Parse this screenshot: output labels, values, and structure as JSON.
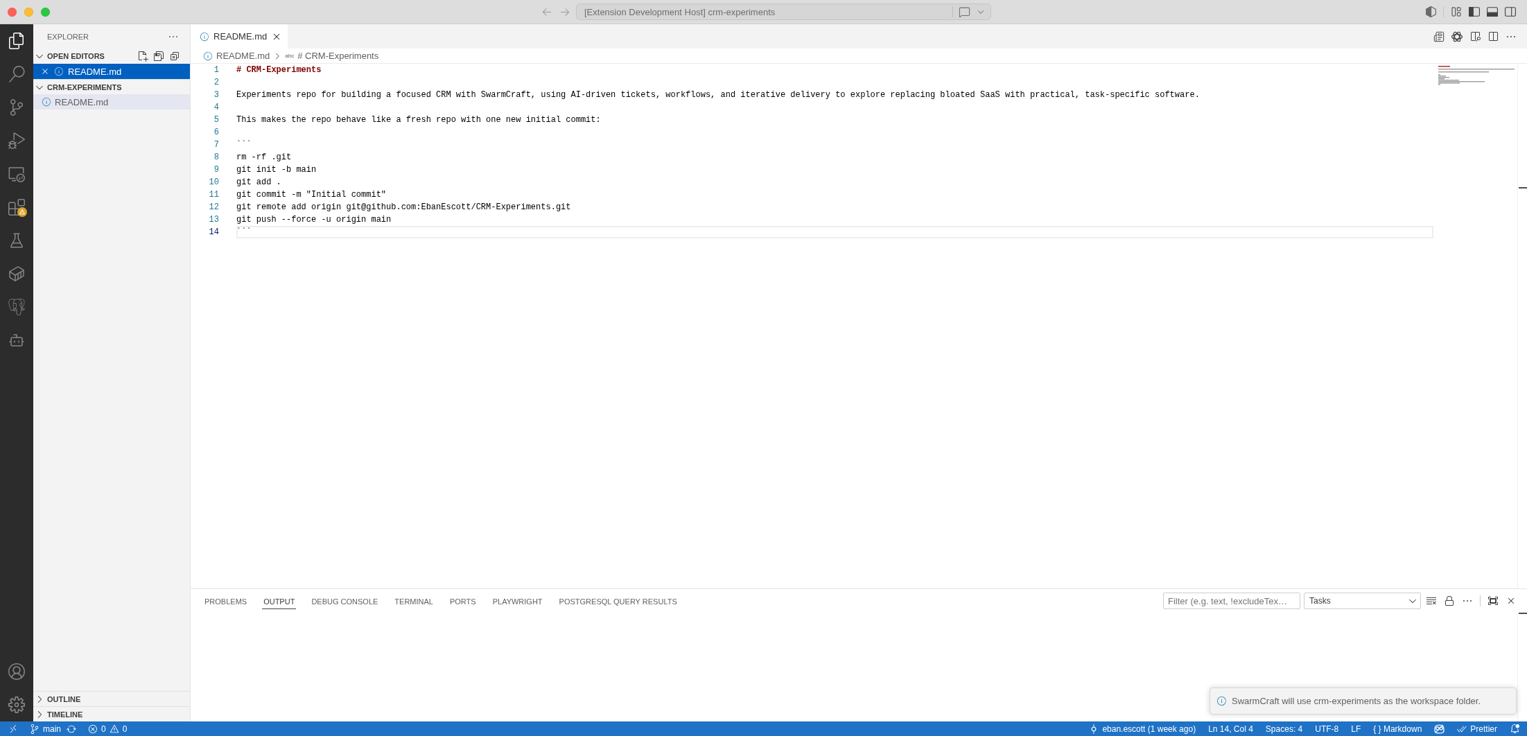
{
  "window": {
    "title": "[Extension Development Host] crm-experiments",
    "layout_toggles": [
      {
        "kind": "primary_sidebar",
        "on": true
      },
      {
        "kind": "panel",
        "on": true
      },
      {
        "kind": "secondary_sidebar",
        "on": false
      }
    ]
  },
  "activity_bar": {
    "items": [
      {
        "kind": "explorer",
        "selected": true,
        "warning": false
      },
      {
        "kind": "search",
        "selected": false,
        "warning": false
      },
      {
        "kind": "source_control",
        "selected": false,
        "warning": false
      },
      {
        "kind": "run_debug",
        "selected": false,
        "warning": false
      },
      {
        "kind": "remote_explorer",
        "selected": false,
        "warning": false
      },
      {
        "kind": "extensions",
        "selected": false,
        "warning": true
      },
      {
        "kind": "testing",
        "selected": false,
        "warning": false
      },
      {
        "kind": "containers",
        "selected": false,
        "warning": false
      },
      {
        "kind": "database",
        "selected": false,
        "warning": false
      },
      {
        "kind": "robot",
        "selected": false,
        "warning": false
      }
    ]
  },
  "sidebar": {
    "title": "EXPLORER",
    "sections": [
      {
        "kind": "open_editors",
        "title": "OPEN EDITORS",
        "expanded": true,
        "items": [
          {
            "label": "README.md",
            "selected": true,
            "focused": true
          }
        ]
      },
      {
        "kind": "folder",
        "title": "CRM-EXPERIMENTS",
        "expanded": true,
        "items": [
          {
            "label": "README.md",
            "selected": true,
            "focused": false
          }
        ]
      }
    ],
    "bottom_sections": [
      {
        "title": "OUTLINE",
        "expanded": false
      },
      {
        "title": "TIMELINE",
        "expanded": false
      }
    ]
  },
  "editor": {
    "tabs": [
      {
        "label": "README.md",
        "selected": true
      }
    ],
    "breadcrumbs": {
      "file": "README.md",
      "symbol_icon": "abc",
      "symbol": "# CRM-Experiments"
    },
    "lines": [
      {
        "number": "1",
        "kind": "heading",
        "text": "# CRM-Experiments",
        "current": false
      },
      {
        "number": "2",
        "current": false
      },
      {
        "number": "3",
        "kind": "plain",
        "text": "Experiments repo for building a focused CRM with SwarmCraft, using AI-driven tickets, workflows, and iterative delivery to explore replacing bloated SaaS with practical, task-specific software.",
        "current": false
      },
      {
        "number": "4",
        "current": false
      },
      {
        "number": "5",
        "kind": "plain",
        "text": "This makes the repo behave like a fresh repo with one new initial commit:",
        "current": false
      },
      {
        "number": "6",
        "current": false
      },
      {
        "number": "7",
        "kind": "plain",
        "text": "```",
        "current": false
      },
      {
        "number": "8",
        "kind": "plain",
        "text": "rm -rf .git",
        "current": false
      },
      {
        "number": "9",
        "kind": "plain",
        "text": "git init -b main",
        "current": false
      },
      {
        "number": "10",
        "kind": "plain",
        "text": "git add .",
        "current": false
      },
      {
        "number": "11",
        "kind": "plain",
        "text": "git commit -m \"Initial commit\"",
        "current": false
      },
      {
        "number": "12",
        "kind": "plain",
        "text": "git remote add origin git@github.com:EbanEscott/CRM-Experiments.git",
        "current": false
      },
      {
        "number": "13",
        "kind": "plain",
        "text": "git push --force -u origin main",
        "current": false
      },
      {
        "number": "14",
        "kind": "plain",
        "text": "```",
        "current": true
      }
    ]
  },
  "panel": {
    "tabs": [
      {
        "label": "PROBLEMS",
        "selected": false
      },
      {
        "label": "OUTPUT",
        "selected": true
      },
      {
        "label": "DEBUG CONSOLE",
        "selected": false
      },
      {
        "label": "TERMINAL",
        "selected": false
      },
      {
        "label": "PORTS",
        "selected": false
      },
      {
        "label": "PLAYWRIGHT",
        "selected": false
      },
      {
        "label": "POSTGRESQL QUERY RESULTS",
        "selected": false
      }
    ],
    "filter": {
      "placeholder": "Filter (e.g. text, !excludeTex…"
    },
    "channel": {
      "value": "Tasks"
    }
  },
  "notification": {
    "message": "SwarmCraft will use crm-experiments as the workspace folder."
  },
  "status_bar": {
    "branch": "main",
    "errors": "0",
    "warnings": "0",
    "blame": "eban.escott (1 week ago)",
    "cursor": "Ln 14, Col 4",
    "indentation": "Spaces: 4",
    "encoding": "UTF-8",
    "eol": "LF",
    "language_icon": "{ }",
    "language": "Markdown",
    "formatter": "Prettier",
    "bell_dot": true
  }
}
